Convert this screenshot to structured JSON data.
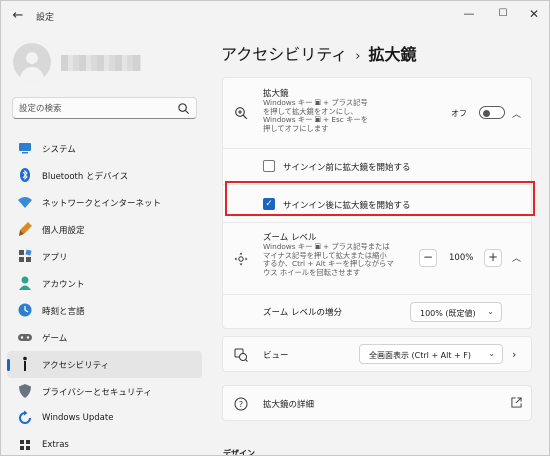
{
  "window": {
    "title": "設定",
    "back_icon": "←",
    "minimize_icon": "—",
    "maximize_icon": "☐",
    "close_icon": "✕"
  },
  "search": {
    "placeholder": "設定の検索"
  },
  "sidebar": {
    "items": [
      {
        "label": "システム",
        "icon": "system-icon",
        "color": "#2d7fd3"
      },
      {
        "label": "Bluetooth とデバイス",
        "icon": "bluetooth-icon",
        "color": "#1e6ad1"
      },
      {
        "label": "ネットワークとインターネット",
        "icon": "network-icon",
        "color": "#3a8ad6"
      },
      {
        "label": "個人用設定",
        "icon": "personalization-icon",
        "color": "#d98b2a"
      },
      {
        "label": "アプリ",
        "icon": "apps-icon",
        "color": "#555555"
      },
      {
        "label": "アカウント",
        "icon": "account-icon",
        "color": "#2aa38a"
      },
      {
        "label": "時刻と言語",
        "icon": "time-language-icon",
        "color": "#2d7fd3"
      },
      {
        "label": "ゲーム",
        "icon": "gaming-icon",
        "color": "#666666"
      },
      {
        "label": "アクセシビリティ",
        "icon": "accessibility-icon",
        "color": "#1a1a1a"
      },
      {
        "label": "プライバシーとセキュリティ",
        "icon": "privacy-icon",
        "color": "#6b7280"
      },
      {
        "label": "Windows Update",
        "icon": "windows-update-icon",
        "color": "#1e6ad1"
      },
      {
        "label": "Extras",
        "icon": "extras-icon",
        "color": "#333333"
      }
    ],
    "active_index": 8
  },
  "breadcrumb": {
    "parent": "アクセシビリティ",
    "separator": "›",
    "current": "拡大鏡"
  },
  "magnifier": {
    "title": "拡大鏡",
    "desc_line1": "Windows キー 🞕 + プラス記号",
    "desc_line2": "を押して拡大鏡をオンにし、",
    "desc_line3": "Windows キー 🞕 + Esc キーを",
    "desc_line4": "押してオフにします",
    "toggle_label": "オフ",
    "toggle_on": false
  },
  "checkboxes": {
    "before_signin": {
      "label": "サインイン前に拡大鏡を開始する",
      "checked": false
    },
    "after_signin": {
      "label": "サインイン後に拡大鏡を開始する",
      "checked": true
    }
  },
  "zoom": {
    "title": "ズーム レベル",
    "desc_line1": "Windows キー 🞕 + プラス記号または",
    "desc_line2": "マイナス記号を押して拡大または縮小",
    "desc_line3": "するか、Ctrl + Alt キーを押しながらマ",
    "desc_line4": "ウス ホイールを回転させます",
    "minus": "−",
    "value": "100%",
    "plus": "+"
  },
  "zoom_increment": {
    "label": "ズーム レベルの増分",
    "value": "100% (既定値)"
  },
  "view": {
    "label": "ビュー",
    "value": "全画面表示 (Ctrl + Alt + F)"
  },
  "details": {
    "label": "拡大鏡の詳細"
  },
  "section_next": "デザイン",
  "colors": {
    "accent": "#1a65c2",
    "highlight": "#e0252b"
  }
}
